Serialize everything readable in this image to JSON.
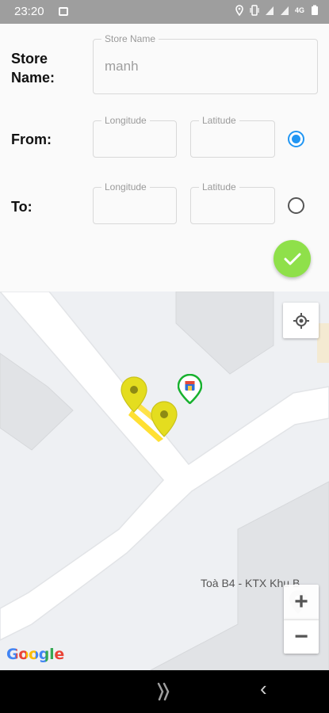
{
  "status_bar": {
    "time": "23:20",
    "network": "4G"
  },
  "form": {
    "store_name": {
      "label": "Store\nName:",
      "legend": "Store Name",
      "value": "manh"
    },
    "from": {
      "label": "From:",
      "longitude_legend": "Longitude",
      "latitude_legend": "Latitude",
      "longitude_value": "",
      "latitude_value": "",
      "selected": true
    },
    "to": {
      "label": "To:",
      "longitude_legend": "Longitude",
      "latitude_legend": "Latitude",
      "longitude_value": "",
      "latitude_value": "",
      "selected": false
    }
  },
  "map": {
    "place_label": "Toà B4 - KTX Khu B",
    "zoom_in": "+",
    "zoom_out": "−",
    "google_logo": "Google",
    "route_color": "#ffe033",
    "marker_color": "#e4dd1f"
  },
  "nav": {
    "back_glyph": "‹"
  }
}
